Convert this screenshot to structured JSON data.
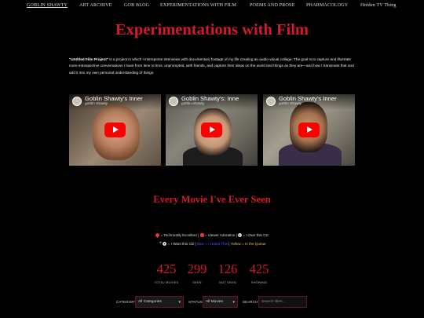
{
  "nav": {
    "items": [
      {
        "label": "GOBLIN SHAWTY"
      },
      {
        "label": "ART ARCHIVE"
      },
      {
        "label": "GOB BLOG"
      },
      {
        "label": "EXPERIMENTATIONS WITH FILM"
      },
      {
        "label": "POEMS AND PROSE"
      },
      {
        "label": "PHARMACOLOGY"
      },
      {
        "label": "Hidden TV Thing"
      }
    ]
  },
  "page": {
    "title": "Experimentations with Film",
    "intro_bold": "\"Untitled Film Project\"",
    "intro_text": " is a project in which I intersperse interviews with documentary footage of my life creating an audio-visual collage. The goal is to capture and illustrate more introspective conversations I have from time to time, unprompted, with friends, and capture their ideas on the world and things as they are—and how I transmute that and add it into my own personal understanding of things."
  },
  "videos": [
    {
      "title": "Goblin Shawty's Inner",
      "channel": "goblin shawty"
    },
    {
      "title": "Goblin Shawty's: Inne",
      "channel": "goblin shawty"
    },
    {
      "title": "Goblin Shawty's Inner",
      "channel": "goblin shawty"
    }
  ],
  "movies": {
    "heading": "Every Movie I've Ever Seen",
    "legend": {
      "technically_excellent": "= Technically Excellent",
      "viewer_adoration": "= Viewer Adoration",
      "own_cd": "= I Own this CD",
      "want_cd": "= I Want this CD",
      "blue_text": "Blue = I Hated This",
      "yellow_text": "Yellow = In the Queue",
      "sep": "|"
    },
    "stats": [
      {
        "value": "425",
        "label": "TOTAL MOVIES"
      },
      {
        "value": "299",
        "label": "SEEN"
      },
      {
        "value": "126",
        "label": "NOT SEEN"
      },
      {
        "value": "425",
        "label": "SHOWING"
      }
    ],
    "filters": {
      "category_label": "CATEGORY",
      "category_value": "All Categories",
      "status_label": "STATUS",
      "status_value": "All Movies",
      "search_label": "SEARCH",
      "search_placeholder": "Search titles..."
    }
  },
  "colors": {
    "accent": "#d21a2c",
    "background": "#000000",
    "blue": "#3b5cff",
    "yellow": "#e8c64a"
  }
}
